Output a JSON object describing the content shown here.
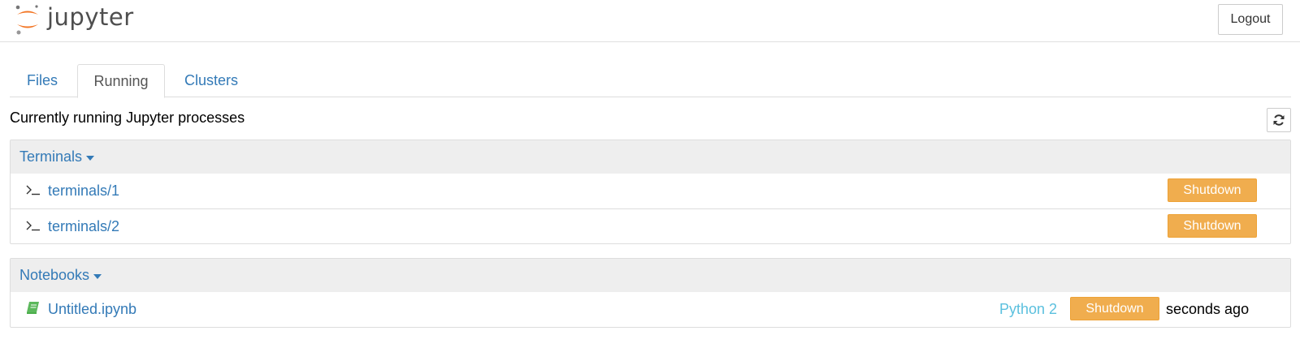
{
  "header": {
    "logo_text": "jupyter",
    "logout_label": "Logout",
    "brand_color": "#f37726"
  },
  "tabs": [
    {
      "label": "Files",
      "active": false
    },
    {
      "label": "Running",
      "active": true
    },
    {
      "label": "Clusters",
      "active": false
    }
  ],
  "running": {
    "description": "Currently running Jupyter processes",
    "refresh_icon": "refresh-icon"
  },
  "terminals": {
    "title": "Terminals",
    "items": [
      {
        "icon": "terminal-icon",
        "name": "terminals/1",
        "action": "Shutdown"
      },
      {
        "icon": "terminal-icon",
        "name": "terminals/2",
        "action": "Shutdown"
      }
    ]
  },
  "notebooks": {
    "title": "Notebooks",
    "items": [
      {
        "icon": "notebook-icon",
        "name": "Untitled.ipynb",
        "kernel": "Python 2",
        "action": "Shutdown",
        "last_activity": "seconds ago"
      }
    ]
  },
  "colors": {
    "link": "#337ab7",
    "warning": "#f0ad4e",
    "kernel_info": "#5bc0de",
    "notebook_icon": "#5cb85c"
  }
}
